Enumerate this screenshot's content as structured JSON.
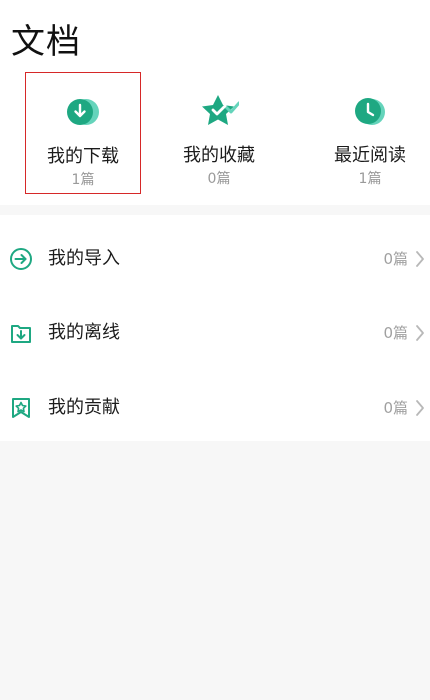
{
  "page_title": "文档",
  "quick_access": [
    {
      "label": "我的下载",
      "count": "1篇",
      "icon": "cloud-download-icon",
      "selected": true
    },
    {
      "label": "我的收藏",
      "count": "0篇",
      "icon": "star-check-icon",
      "selected": false
    },
    {
      "label": "最近阅读",
      "count": "1篇",
      "icon": "clock-icon",
      "selected": false
    }
  ],
  "list_items": [
    {
      "label": "我的导入",
      "count": "0篇",
      "icon": "import-arrow-icon"
    },
    {
      "label": "我的离线",
      "count": "0篇",
      "icon": "folder-download-icon"
    },
    {
      "label": "我的贡献",
      "count": "0篇",
      "icon": "bookmark-star-icon"
    }
  ],
  "colors": {
    "accent": "#1ea882",
    "accent_light": "#65d4bb",
    "selection_border": "#d62828",
    "muted_text": "#a0a0a0"
  }
}
